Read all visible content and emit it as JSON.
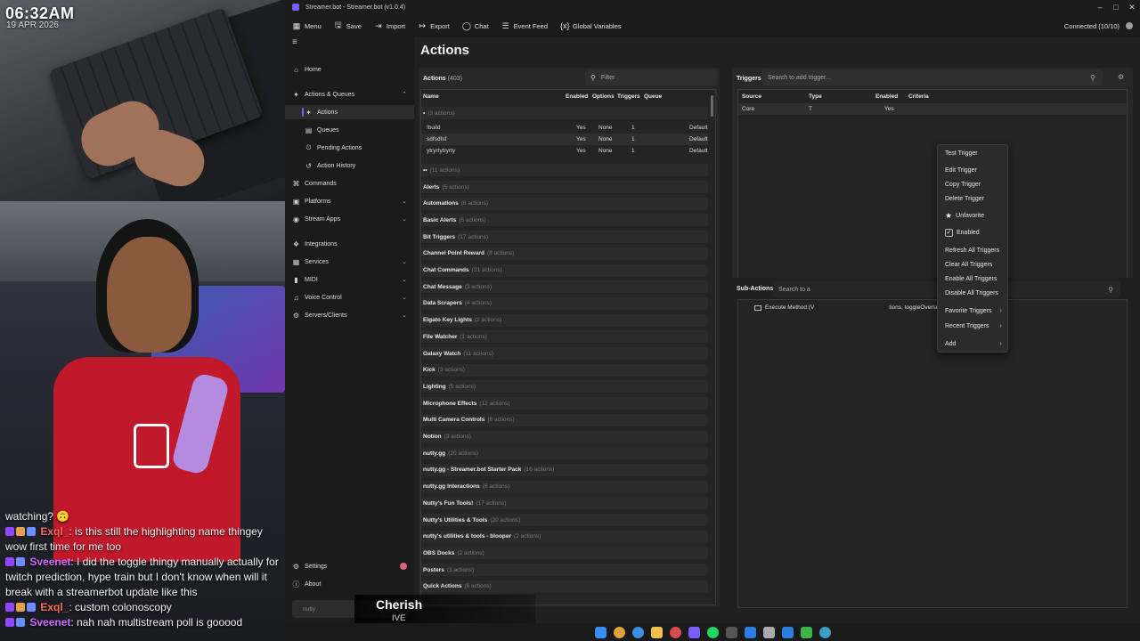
{
  "overlay": {
    "clock_time": "06:32AM",
    "clock_date": "19 APR 2026",
    "chat": [
      {
        "user": "",
        "text": "watching? 🙃",
        "badges": []
      },
      {
        "user": "Exql_",
        "text": ": is this still the highlighting name thingey",
        "badges": [
          "twitch-icon",
          "gift-icon",
          "sub-icon"
        ],
        "user_color": "#ff6b5a"
      },
      {
        "user": "",
        "text": "wow first time for me too",
        "badges": []
      },
      {
        "user": "Sveenet",
        "text": ": I did the toggle thingy manually actually for",
        "badges": [
          "twitch-icon",
          "sub-icon"
        ],
        "user_color": "#d06bff"
      },
      {
        "user": "",
        "text": "twitch prediction, hype train but I don't know when will it",
        "badges": []
      },
      {
        "user": "",
        "text": "break with a streamerbot update like this",
        "badges": []
      },
      {
        "user": "Exql_",
        "text": ": custom colonoscopy",
        "badges": [
          "twitch-icon",
          "gift-icon",
          "sub-icon"
        ],
        "user_color": "#ff6b5a"
      },
      {
        "user": "Sveenet",
        "text": ": nah nah multistream poll is gooood",
        "badges": [
          "twitch-icon",
          "sub-icon"
        ],
        "user_color": "#d06bff"
      }
    ],
    "now_playing_title": "Cherish",
    "now_playing_artist": "IVE"
  },
  "app": {
    "window_title": "Streamer.bot - Streamer.bot (v1.0.4)",
    "toolbar": {
      "menu": "Menu",
      "save": "Save",
      "import": "Import",
      "export": "Export",
      "chat": "Chat",
      "event_feed": "Event Feed",
      "global_variables": "Global Variables"
    },
    "connection": "Connected (10/10)",
    "sidebar": {
      "home": "Home",
      "actions_queues": "Actions & Queues",
      "actions": "Actions",
      "queues": "Queues",
      "pending_actions": "Pending Actions",
      "action_history": "Action History",
      "commands": "Commands",
      "platforms": "Platforms",
      "stream_apps": "Stream Apps",
      "integrations": "Integrations",
      "services": "Services",
      "midi": "MIDI",
      "voice_control": "Voice Control",
      "servers_clients": "Servers/Clients",
      "settings": "Settings",
      "about": "About",
      "bottom_hint": "nutty"
    },
    "page_title": "Actions",
    "actions_panel": {
      "title": "Actions",
      "count": "(403)",
      "filter_placeholder": "Filter",
      "columns": {
        "name": "Name",
        "enabled": "Enabled",
        "options": "Options",
        "triggers": "Triggers",
        "queue": "Queue"
      },
      "top_group": "•",
      "top_group_count": "(3 actions)",
      "rows": [
        {
          "name": "!build",
          "enabled": "Yes",
          "options": "None",
          "triggers": "1",
          "queue": "Default"
        },
        {
          "name": "sdfsdfsf",
          "enabled": "Yes",
          "options": "None",
          "triggers": "1",
          "queue": "Default"
        },
        {
          "name": "ytryrtytryrty",
          "enabled": "Yes",
          "options": "None",
          "triggers": "1",
          "queue": "Default"
        }
      ],
      "second_group": "••",
      "second_group_count": "(11 actions)",
      "groups": [
        {
          "name": "Alerts",
          "count": "(5 actions)"
        },
        {
          "name": "Automations",
          "count": "(6 actions)"
        },
        {
          "name": "Basic Alerts",
          "count": "(5 actions)"
        },
        {
          "name": "Bit Triggers",
          "count": "(17 actions)"
        },
        {
          "name": "Channel Point Reward",
          "count": "(8 actions)"
        },
        {
          "name": "Chat Commands",
          "count": "(21 actions)"
        },
        {
          "name": "Chat Message",
          "count": "(3 actions)"
        },
        {
          "name": "Data Scrapers",
          "count": "(4 actions)"
        },
        {
          "name": "Elgato Key Lights",
          "count": "(2 actions)"
        },
        {
          "name": "File Watcher",
          "count": "(1 actions)"
        },
        {
          "name": "Galaxy Watch",
          "count": "(11 actions)"
        },
        {
          "name": "Kick",
          "count": "(3 actions)"
        },
        {
          "name": "Lighting",
          "count": "(5 actions)"
        },
        {
          "name": "Microphone Effects",
          "count": "(12 actions)"
        },
        {
          "name": "Multi Camera Controls",
          "count": "(8 actions)"
        },
        {
          "name": "Notion",
          "count": "(3 actions)"
        },
        {
          "name": "nutty.gg",
          "count": "(20 actions)"
        },
        {
          "name": "nutty.gg - Streamer.bot Starter Pack",
          "count": "(16 actions)"
        },
        {
          "name": "nutty.gg Interactions",
          "count": "(6 actions)"
        },
        {
          "name": "Nutty's Fun Tools!",
          "count": "(17 actions)"
        },
        {
          "name": "Nutty's Utilities & Tools",
          "count": "(20 actions)"
        },
        {
          "name": "nutty's utilities & tools - blooper",
          "count": "(2 actions)"
        },
        {
          "name": "OBS Docks",
          "count": "(2 actions)"
        },
        {
          "name": "Posters",
          "count": "(3 actions)"
        },
        {
          "name": "Quick Actions",
          "count": "(6 actions)"
        }
      ]
    },
    "triggers_panel": {
      "title": "Triggers",
      "search_placeholder": "Search to add trigger...",
      "columns": {
        "source": "Source",
        "type": "Type",
        "enabled": "Enabled",
        "criteria": "Criteria"
      },
      "row": {
        "source": "Core",
        "type": "T",
        "enabled": "Yes",
        "criteria": ""
      }
    },
    "subactions_panel": {
      "title": "Sub-Actions",
      "search_placeholder": "Search to a",
      "row_left": "Execute Method (V",
      "row_right": "tions, toggleOverlay)"
    },
    "context_menu": [
      {
        "label": "Test Trigger"
      },
      {
        "label": "Edit Trigger"
      },
      {
        "label": "Copy Trigger"
      },
      {
        "label": "Delete Trigger"
      },
      {
        "label": "Unfavorite"
      },
      {
        "label": "Enabled"
      },
      {
        "label": "Refresh All Triggers"
      },
      {
        "label": "Clear All Triggers"
      },
      {
        "label": "Enable All Triggers"
      },
      {
        "label": "Disable All Triggers"
      },
      {
        "label": "Favorite Triggers"
      },
      {
        "label": "Recent Triggers"
      },
      {
        "label": "Add"
      }
    ],
    "accent_color": "#7b5cff"
  }
}
